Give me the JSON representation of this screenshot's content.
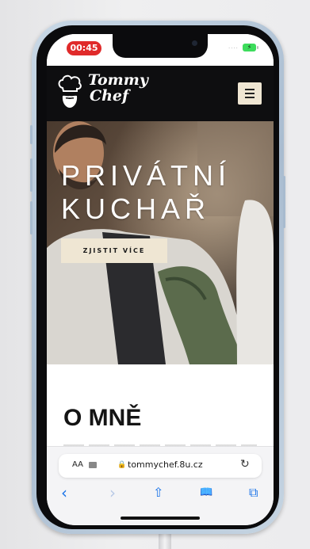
{
  "status_bar": {
    "time": "00:45",
    "signal": "····",
    "battery_icon": "⚡"
  },
  "site": {
    "logo": {
      "line1": "Tommy",
      "line2": "Chef"
    },
    "menu_icon": "hamburger-icon",
    "hero": {
      "title_line1": "PRIVÁTNÍ",
      "title_line2": "KUCHAŘ",
      "button_label": "ZJISTIT VÍCE"
    },
    "about": {
      "title": "O MNĚ"
    }
  },
  "browser": {
    "text_size_label": "AA",
    "url": "tommychef.8u.cz",
    "icons": {
      "back": "‹",
      "forward": "›",
      "share": "⇧",
      "bookmarks": "📖",
      "tabs": "⧉",
      "reload": "↻",
      "lock": "🔒"
    }
  },
  "colors": {
    "header_bg": "#0e0e10",
    "accent_beige": "#efe6d3",
    "status_pill": "#e02a2a",
    "battery": "#3ddc5c",
    "safari_blue": "#1a73e8"
  }
}
